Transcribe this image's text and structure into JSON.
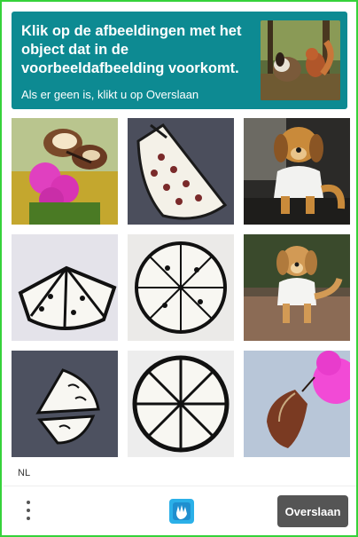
{
  "challenge": {
    "prompt": "Klik op de afbeeldingen met het object dat in de voorbeeldafbeelding voorkomt.",
    "subtext": "Als er geen is, klikt u op Overslaan",
    "example_image": "dog-and-squirrel-in-forest"
  },
  "grid": {
    "tiles": [
      {
        "subject": "butterfly-on-pink-flower"
      },
      {
        "subject": "pizza-slice-drawing"
      },
      {
        "subject": "dog-in-white-shirt"
      },
      {
        "subject": "sliced-pizza-drawing"
      },
      {
        "subject": "whole-pizza-drawing"
      },
      {
        "subject": "dog-in-white-shirt-on-road"
      },
      {
        "subject": "pizza-slices-drawing"
      },
      {
        "subject": "pizza-lines-drawing"
      },
      {
        "subject": "butterfly-on-pink-flower"
      }
    ]
  },
  "footer": {
    "language": "NL",
    "skip_label": "Overslaan"
  },
  "colors": {
    "header_bg": "#0d8a92",
    "border": "#35d23a",
    "skip_bg": "#555555"
  }
}
